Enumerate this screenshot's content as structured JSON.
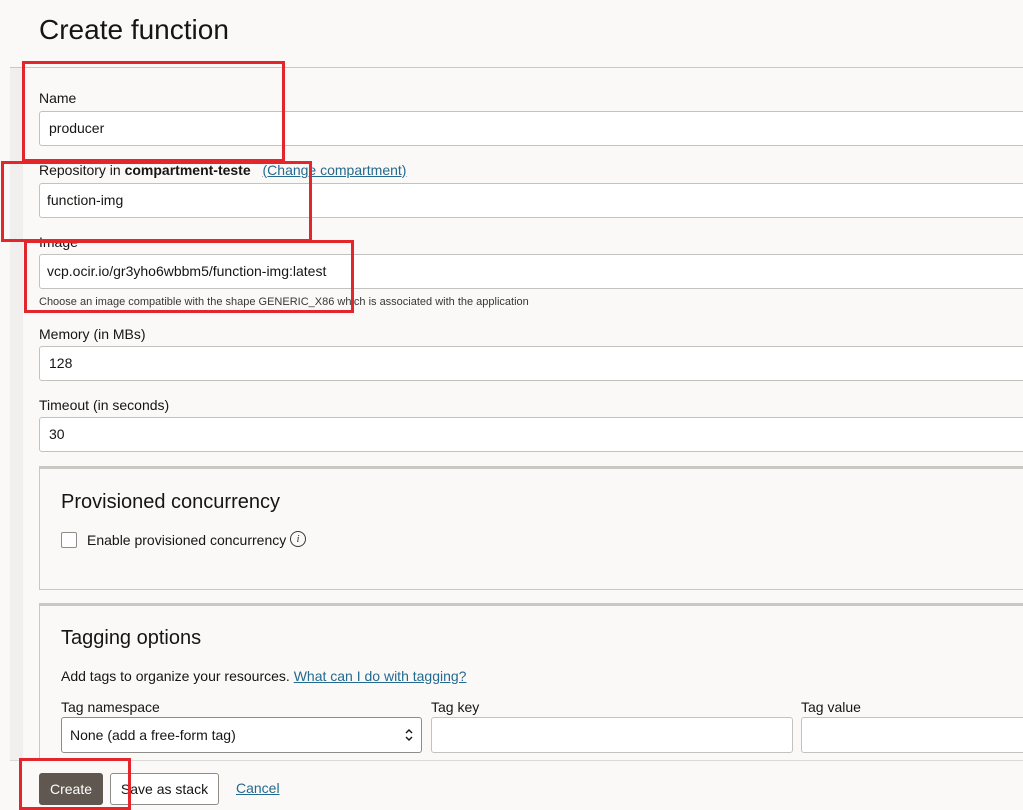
{
  "page": {
    "title": "Create function"
  },
  "form": {
    "name": {
      "label": "Name",
      "value": "producer"
    },
    "repository": {
      "label_prefix": "Repository in ",
      "compartment": "compartment-teste",
      "change_link": "(Change compartment)",
      "value": "function-img"
    },
    "image": {
      "label": "Image",
      "value": "vcp.ocir.io/gr3yho6wbbm5/function-img:latest",
      "help": "Choose an image compatible with the shape GENERIC_X86 which is associated with the application"
    },
    "memory": {
      "label": "Memory (in MBs)",
      "value": "128"
    },
    "timeout": {
      "label": "Timeout (in seconds)",
      "value": "30"
    }
  },
  "provisioned": {
    "title": "Provisioned concurrency",
    "checkbox_label": "Enable provisioned concurrency",
    "checked": false,
    "info_icon": "i"
  },
  "tagging": {
    "title": "Tagging options",
    "intro": "Add tags to organize your resources.",
    "help_link": "What can I do with tagging?",
    "namespace_label": "Tag namespace",
    "key_label": "Tag key",
    "value_label": "Tag value",
    "namespace_selected": "None (add a free-form tag)",
    "key_value": "",
    "value_value": ""
  },
  "footer": {
    "create_label": "Create",
    "save_stack_label": "Save as stack",
    "cancel_label": "Cancel"
  },
  "colors": {
    "primary_button": "#5f5750",
    "link": "#236a8e",
    "highlight": "#e3262b",
    "background": "#fbf9f8"
  }
}
